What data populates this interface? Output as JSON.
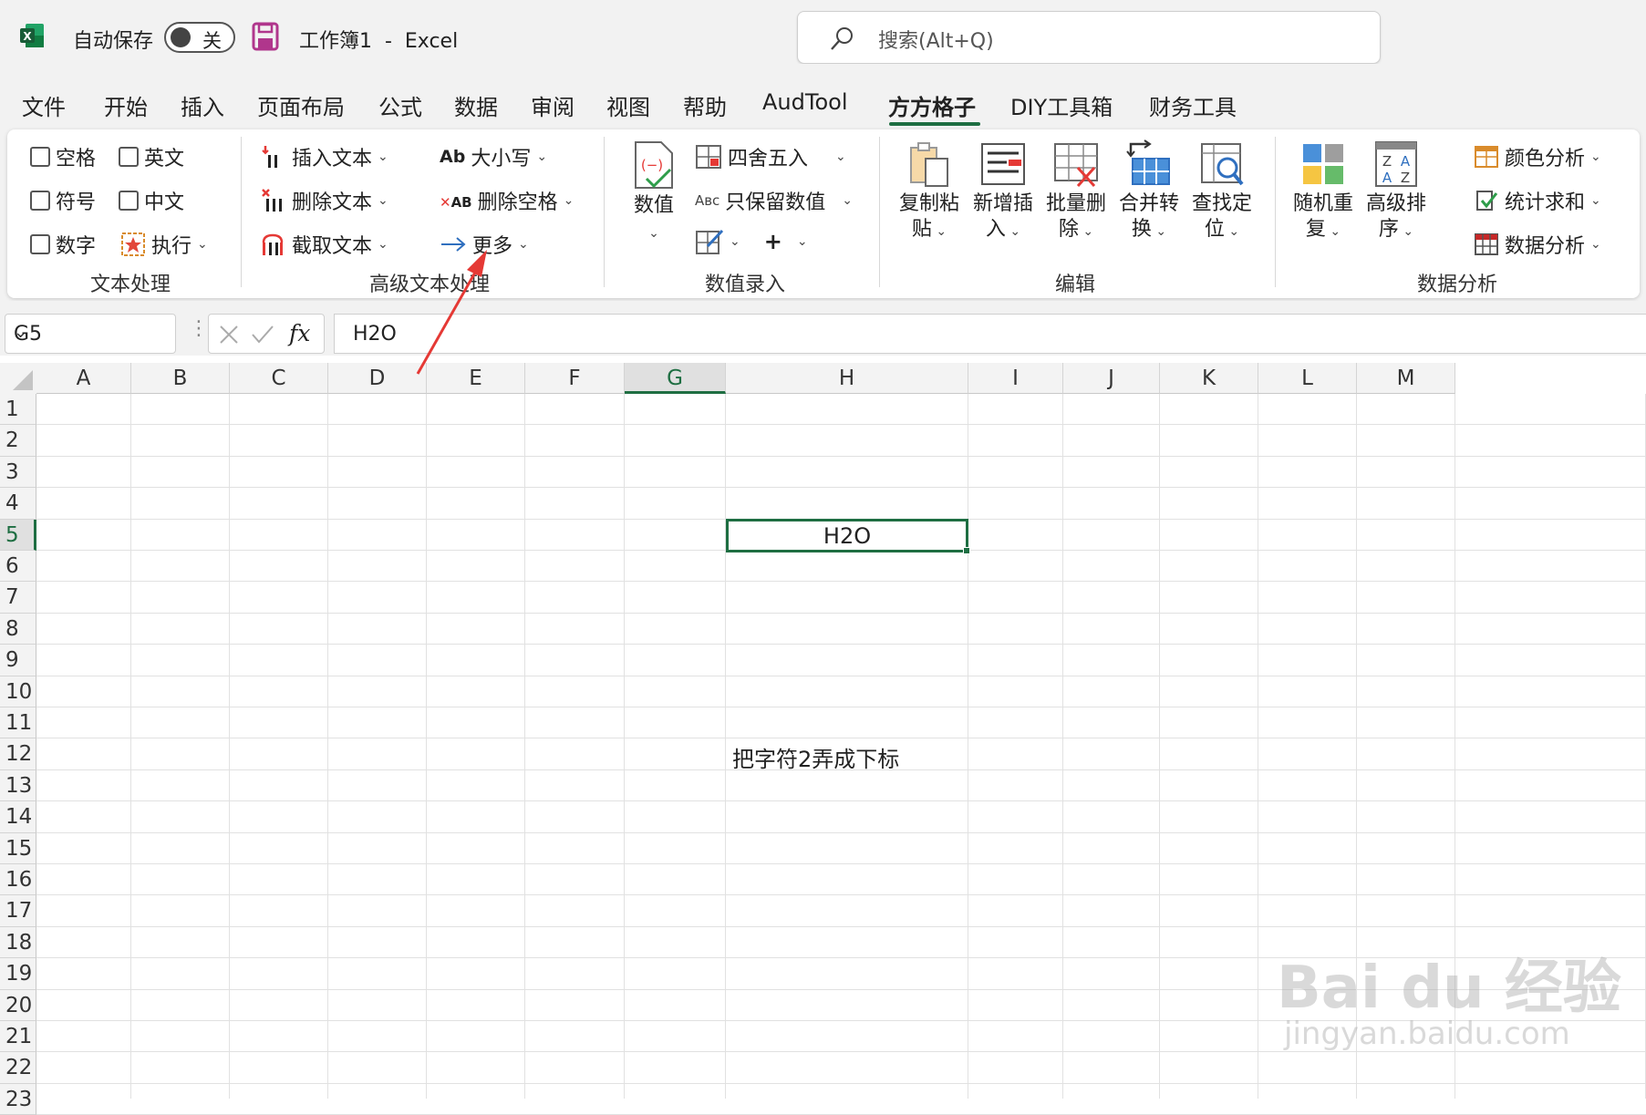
{
  "app": {
    "autosave_label": "自动保存",
    "autosave_state": "关",
    "doc_title": "工作簿1  -  Excel",
    "search_placeholder": "搜索(Alt+Q)"
  },
  "menu": [
    "文件",
    "开始",
    "插入",
    "页面布局",
    "公式",
    "数据",
    "审阅",
    "视图",
    "帮助",
    "AudTool",
    "方方格子",
    "DIY工具箱",
    "财务工具"
  ],
  "menu_active": "方方格子",
  "ribbon": {
    "text_processing": {
      "checkboxes": [
        "空格",
        "英文",
        "符号",
        "中文",
        "数字"
      ],
      "execute": "执行",
      "label": "文本处理"
    },
    "advanced_text": {
      "insert_text": "插入文本",
      "delete_text": "删除文本",
      "extract_text": "截取文本",
      "case": "大小写",
      "delete_space": "删除空格",
      "more": "更多",
      "label": "高级文本处理"
    },
    "numeric_entry": {
      "value": "数值",
      "round": "四舍五入",
      "keep_values": "只保留数值",
      "label": "数值录入"
    },
    "edit": {
      "copy_paste": [
        "复制粘",
        "贴"
      ],
      "insert_new": [
        "新增插",
        "入"
      ],
      "batch_delete": [
        "批量删",
        "除"
      ],
      "merge_convert": [
        "合并转",
        "换"
      ],
      "find_locate": [
        "查找定",
        "位"
      ],
      "label": "编辑"
    },
    "data_analysis": {
      "random_repeat": [
        "随机重",
        "复"
      ],
      "advanced_sort": [
        "高级排",
        "序"
      ],
      "color_analysis": "颜色分析",
      "stat_sum": "统计求和",
      "data_analysis": "数据分析",
      "label": "数据分析"
    }
  },
  "formula_bar": {
    "name_box": "G5",
    "fx": "fx",
    "content": "H2O"
  },
  "sheet": {
    "columns": [
      "A",
      "B",
      "C",
      "D",
      "E",
      "F",
      "G",
      "H",
      "I",
      "J",
      "K",
      "L",
      "M"
    ],
    "rows": [
      "1",
      "2",
      "3",
      "4",
      "5",
      "6",
      "7",
      "8",
      "9",
      "10",
      "11",
      "12",
      "13",
      "14",
      "15",
      "16",
      "17",
      "18",
      "19",
      "20",
      "21",
      "22",
      "23"
    ],
    "selected_column": "G",
    "selected_row": "5",
    "cell_g5": "H2O",
    "cell_g12": "把字符2弄成下标"
  },
  "watermark": {
    "main": "Bai du 经验",
    "sub": "jingyan.baidu.com"
  },
  "colors": {
    "excel_green": "#1e6e42",
    "annotation_red": "#e53935"
  }
}
